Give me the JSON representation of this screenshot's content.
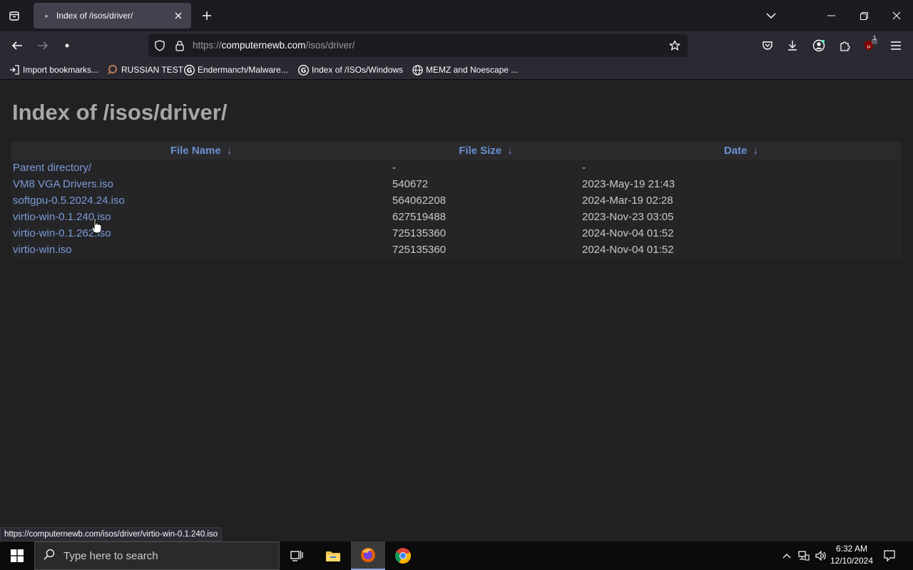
{
  "browser": {
    "tab": {
      "title": "Index of /isos/driver/"
    },
    "url": {
      "scheme": "https://",
      "domain": "computernewb.com",
      "path": "/isos/driver/"
    },
    "bookmarks": [
      {
        "label": "Import bookmarks...",
        "icon": "import-icon"
      },
      {
        "label": "RUSSIAN TEST",
        "icon": "magnifier-icon"
      },
      {
        "label": "Endermanch/Malware...",
        "icon": "google-icon"
      },
      {
        "label": "Index of /ISOs/Windows",
        "icon": "google-icon"
      },
      {
        "label": "MEMZ and Noescape ...",
        "icon": "globe-icon"
      }
    ],
    "extension_badge": "1",
    "status_url": "https://computernewb.com/isos/driver/virtio-win-0.1.240.iso"
  },
  "page": {
    "heading": "Index of /isos/driver/",
    "columns": [
      "File Name",
      "File Size",
      "Date"
    ],
    "sort_arrow": "↓",
    "rows": [
      {
        "name": "Parent directory/",
        "size": "-",
        "date": "-"
      },
      {
        "name": "VM8 VGA Drivers.iso",
        "size": "540672",
        "date": "2023-May-19 21:43"
      },
      {
        "name": "softgpu-0.5.2024.24.iso",
        "size": "564062208",
        "date": "2024-Mar-19 02:28"
      },
      {
        "name": "virtio-win-0.1.240.iso",
        "size": "627519488",
        "date": "2023-Nov-23 03:05"
      },
      {
        "name": "virtio-win-0.1.262.iso",
        "size": "725135360",
        "date": "2024-Nov-04 01:52"
      },
      {
        "name": "virtio-win.iso",
        "size": "725135360",
        "date": "2024-Nov-04 01:52"
      }
    ]
  },
  "taskbar": {
    "search_placeholder": "Type here to search",
    "time": "6:32 AM",
    "date": "12/10/2024"
  }
}
